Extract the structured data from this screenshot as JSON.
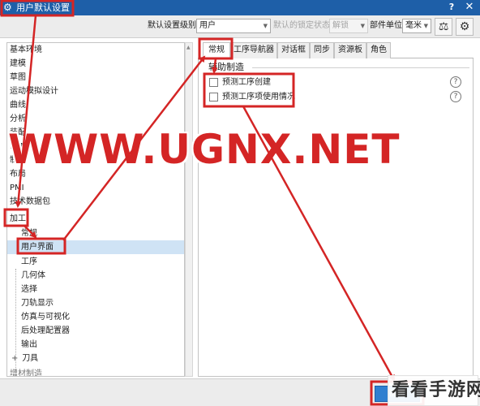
{
  "window": {
    "title": "用户默认设置",
    "help_label": "?",
    "close_label": "✕"
  },
  "toolbar": {
    "level_label": "默认设置级别",
    "level_value": "用户",
    "lock_status_label": "默认的锁定状态",
    "lock_status_value": "解锁",
    "units_label": "部件单位",
    "units_value": "毫米",
    "icons": [
      "scale-icon",
      "settings-icon"
    ]
  },
  "tree": {
    "items": [
      {
        "label": "基本环境"
      },
      {
        "label": "建模"
      },
      {
        "label": "草图"
      },
      {
        "label": "运动模拟设计"
      },
      {
        "label": "曲线"
      },
      {
        "label": "分析"
      },
      {
        "label": "装配"
      },
      {
        "label": "DMU"
      },
      {
        "label": "制图"
      },
      {
        "label": "布局"
      },
      {
        "label": "PMI"
      },
      {
        "label": "技术数据包"
      },
      {
        "label": "加工",
        "expanded": true
      },
      {
        "label": "常规"
      },
      {
        "label": "用户界面",
        "selected": true
      },
      {
        "label": "工序"
      },
      {
        "label": "几何体"
      },
      {
        "label": "选择"
      },
      {
        "label": "刀轨显示"
      },
      {
        "label": "仿真与可视化"
      },
      {
        "label": "后处理配置器"
      },
      {
        "label": "输出"
      },
      {
        "label": "刀具",
        "expander": "+"
      },
      {
        "label": "增材制造"
      }
    ]
  },
  "tabs": [
    {
      "label": "常规",
      "active": true
    },
    {
      "label": "工序导航器"
    },
    {
      "label": "对话框"
    },
    {
      "label": "同步"
    },
    {
      "label": "资源板"
    },
    {
      "label": "角色"
    }
  ],
  "content": {
    "group_title": "辅助制造",
    "options": [
      {
        "label": "预测工序创建",
        "checked": false
      },
      {
        "label": "预测工序项使用情况",
        "checked": false
      }
    ],
    "help_icon_label": "?"
  },
  "footer": {
    "ok_label": "确定"
  },
  "watermark": {
    "text": "WWW.UGNX.NET"
  },
  "stamp": {
    "text": "看看手游网"
  },
  "colors": {
    "titlebar": "#1e5fa8",
    "annotation": "#d42525",
    "selection": "#cfe3f5"
  }
}
